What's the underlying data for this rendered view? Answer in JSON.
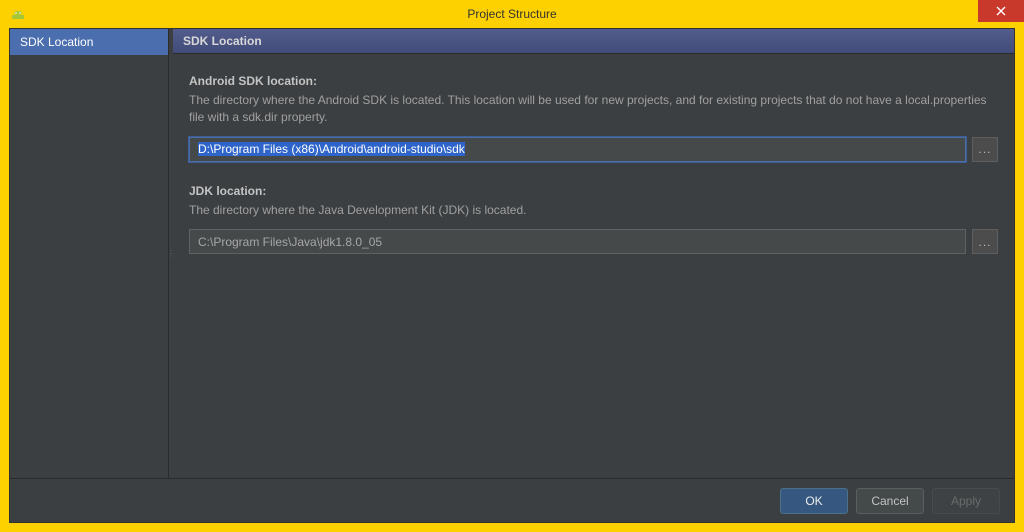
{
  "window": {
    "title": "Project Structure"
  },
  "sidebar": {
    "items": [
      {
        "label": "SDK Location",
        "selected": true
      }
    ]
  },
  "panel": {
    "header": "SDK Location",
    "sdk": {
      "label": "Android SDK location:",
      "description": "The directory where the Android SDK is located. This location will be used for new projects, and for existing projects that do not have a local.properties file with a sdk.dir property.",
      "value": "D:\\Program Files (x86)\\Android\\android-studio\\sdk",
      "browse_btn": "..."
    },
    "jdk": {
      "label": "JDK location:",
      "description": "The directory where the Java Development Kit (JDK) is located.",
      "value": "C:\\Program Files\\Java\\jdk1.8.0_05",
      "browse_btn": "..."
    }
  },
  "buttons": {
    "ok": "OK",
    "cancel": "Cancel",
    "apply": "Apply"
  }
}
